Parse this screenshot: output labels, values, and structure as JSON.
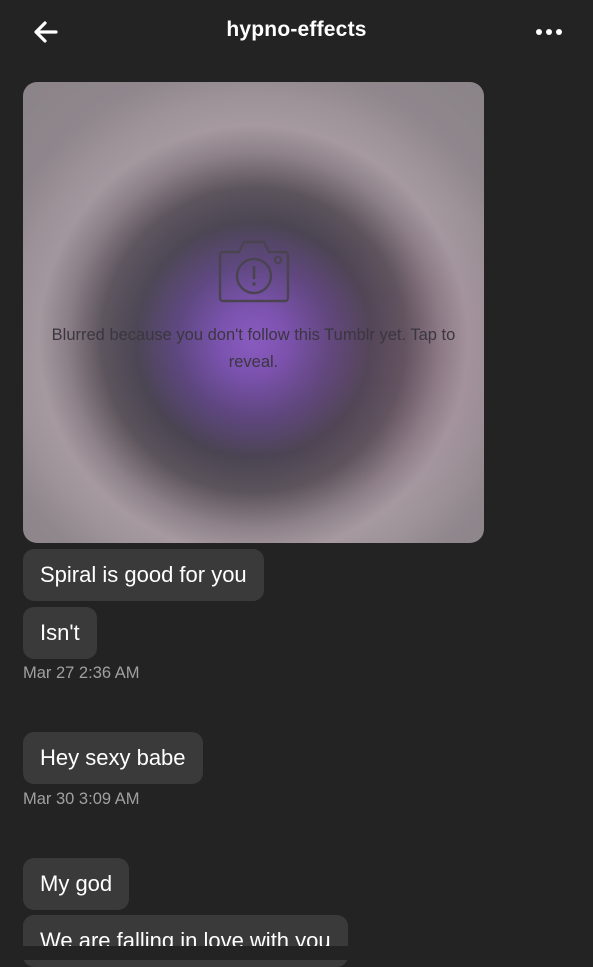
{
  "header": {
    "title": "hypno-effects",
    "back_icon": "arrow-left-icon",
    "more_icon": "more-horizontal-icon"
  },
  "media": {
    "notice": "Blurred because you don't follow this Tumblr yet. Tap to reveal.",
    "icon": "camera-warning-icon"
  },
  "messages": [
    {
      "text": "Spiral is good for you"
    },
    {
      "text": "Isn't"
    },
    {
      "timestamp": "Mar 27 2:36 AM"
    },
    {
      "text": "Hey sexy babe"
    },
    {
      "timestamp": "Mar 30 3:09 AM"
    },
    {
      "text": "My god"
    },
    {
      "text": "We are falling in love with you"
    }
  ],
  "colors": {
    "background": "#232323",
    "bubble": "#3a3a3a",
    "timestamp": "#a0a0a0",
    "accent_purple": "#8a5bc6"
  }
}
